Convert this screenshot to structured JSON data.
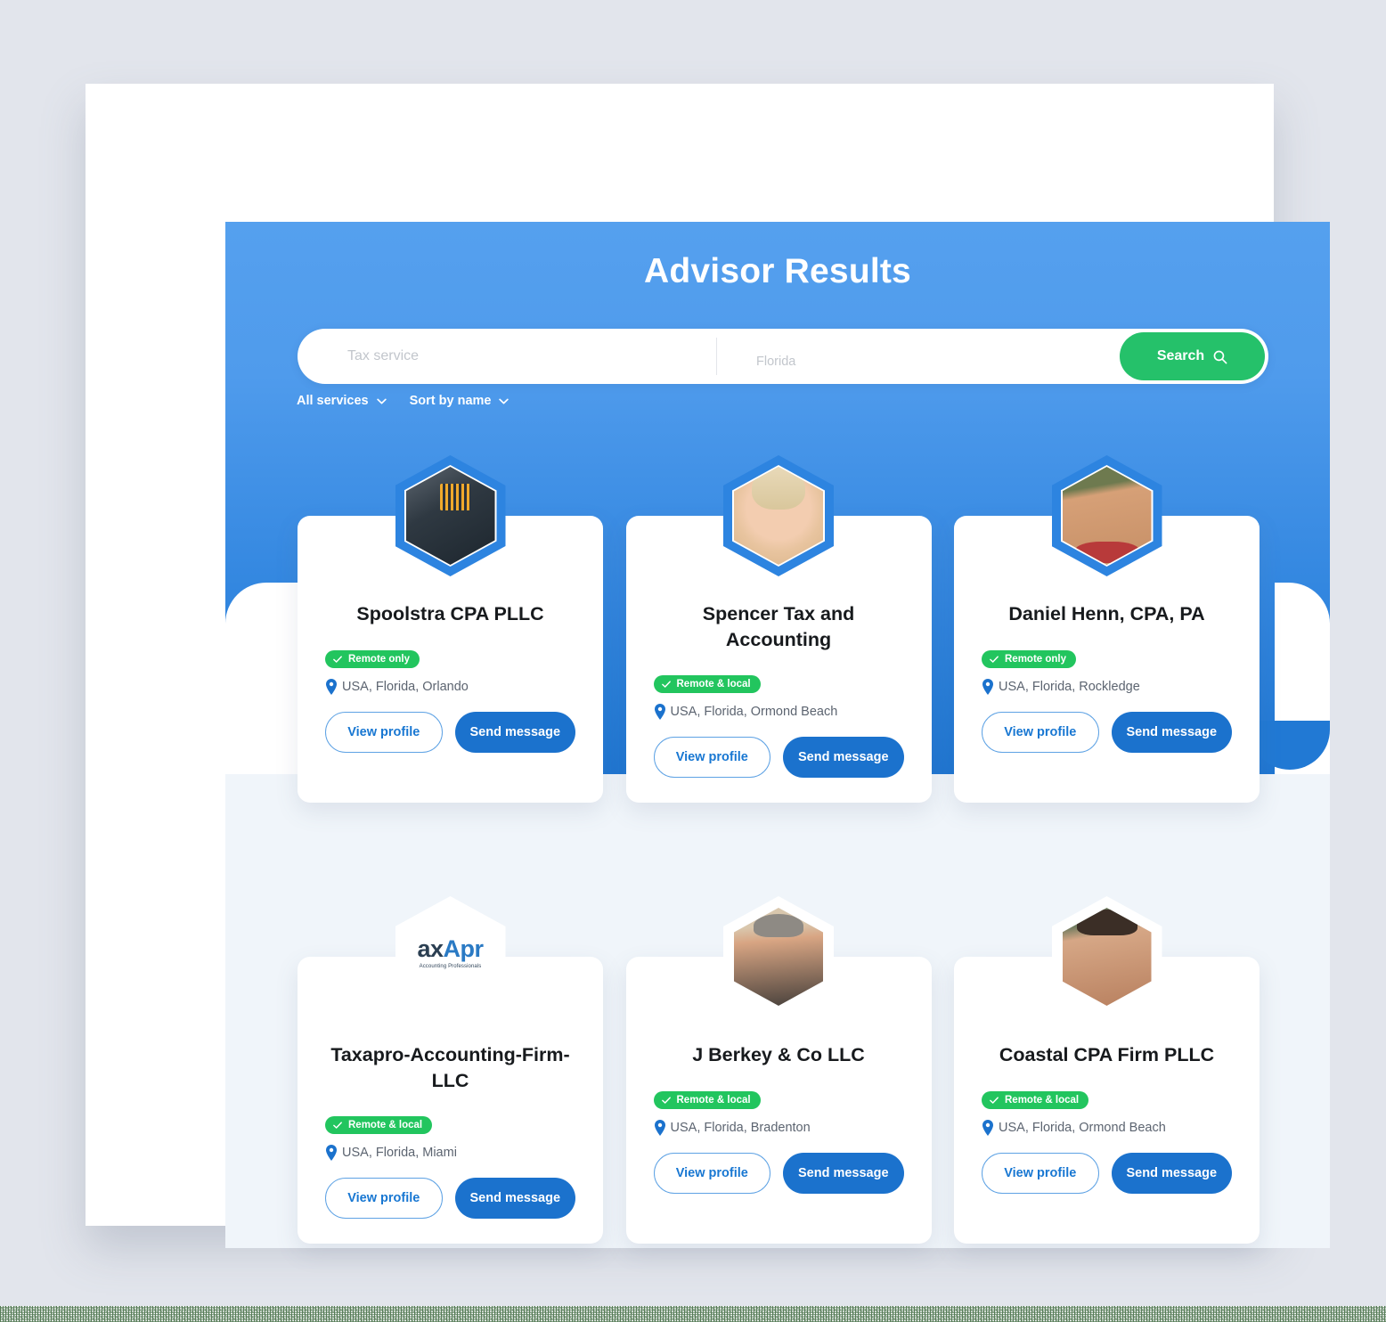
{
  "header": {
    "title": "Advisor Results"
  },
  "search": {
    "service_placeholder": "Tax service",
    "service_value": "",
    "location_placeholder": "Florida",
    "location_value": "",
    "button_label": "Search",
    "button_icon": "search-icon",
    "button_color": "#25c16a"
  },
  "filters": [
    {
      "label": "All services",
      "icon": "chevron-down-icon"
    },
    {
      "label": "Sort by name",
      "icon": "chevron-down-icon"
    }
  ],
  "labels": {
    "view_profile": "View profile",
    "send_message": "Send message",
    "check_icon": "check-icon",
    "pin_icon": "map-pin-icon"
  },
  "colors": {
    "hero_top": "#55a0ee",
    "hero_bottom": "#1f76d2",
    "accent_blue": "#1b72cd",
    "badge_green": "#22c55e",
    "panel_bg": "#f0f5fa",
    "page_bg": "#e2e5ec"
  },
  "cards": [
    {
      "name": "Spoolstra CPA PLLC",
      "badge": "Remote only",
      "location": "USA, Florida, Orlando",
      "avatar": "logo-spoolstra",
      "ring": "blue",
      "view_profile": "View profile",
      "send_message": "Send message"
    },
    {
      "name": "Spencer Tax and Accounting",
      "badge": "Remote & local",
      "location": "USA, Florida, Ormond Beach",
      "avatar": "photo-spencer",
      "ring": "blue",
      "view_profile": "View profile",
      "send_message": "Send message"
    },
    {
      "name": "Daniel Henn, CPA, PA",
      "badge": "Remote only",
      "location": "USA, Florida, Rockledge",
      "avatar": "photo-daniel-henn",
      "ring": "blue",
      "view_profile": "View profile",
      "send_message": "Send message"
    },
    {
      "name": "Taxapro-Accounting-Firm-LLC",
      "badge": "Remote & local",
      "location": "USA, Florida, Miami",
      "avatar": "logo-taxapro",
      "ring": "white",
      "logo_text_main": "axApr",
      "logo_text_sub": "Accounting Professionals",
      "view_profile": "View profile",
      "send_message": "Send message"
    },
    {
      "name": "J Berkey & Co LLC",
      "badge": "Remote & local",
      "location": "USA, Florida, Bradenton",
      "avatar": "photo-j-berkey",
      "ring": "white",
      "view_profile": "View profile",
      "send_message": "Send message"
    },
    {
      "name": "Coastal CPA Firm PLLC",
      "badge": "Remote & local",
      "location": "USA, Florida, Ormond Beach",
      "avatar": "photo-coastal-cpa",
      "ring": "white",
      "view_profile": "View profile",
      "send_message": "Send message"
    }
  ]
}
